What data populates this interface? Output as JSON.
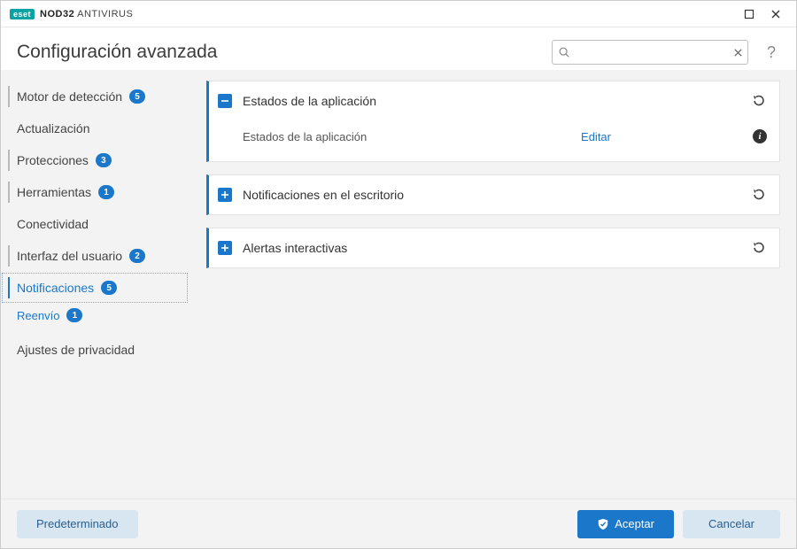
{
  "titlebar": {
    "brand_badge": "eset",
    "brand_bold": "NOD32",
    "brand_rest": "ANTIVIRUS"
  },
  "header": {
    "title": "Configuración avanzada",
    "search_placeholder": ""
  },
  "sidebar": {
    "items": [
      {
        "label": "Motor de detección",
        "badge": "5",
        "accent": true
      },
      {
        "label": "Actualización",
        "badge": null,
        "accent": false
      },
      {
        "label": "Protecciones",
        "badge": "3",
        "accent": true
      },
      {
        "label": "Herramientas",
        "badge": "1",
        "accent": true
      },
      {
        "label": "Conectividad",
        "badge": null,
        "accent": false
      },
      {
        "label": "Interfaz del usuario",
        "badge": "2",
        "accent": true
      },
      {
        "label": "Notificaciones",
        "badge": "5",
        "accent": true,
        "active": true,
        "selected": true,
        "sub": [
          {
            "label": "Reenvío",
            "badge": "1"
          }
        ]
      },
      {
        "label": "Ajustes de privacidad",
        "badge": null,
        "accent": false
      }
    ]
  },
  "main": {
    "panels": [
      {
        "title": "Estados de la aplicación",
        "expanded": true,
        "rows": [
          {
            "label": "Estados de la aplicación",
            "action": "Editar"
          }
        ]
      },
      {
        "title": "Notificaciones en el escritorio",
        "expanded": false
      },
      {
        "title": "Alertas interactivas",
        "expanded": false
      }
    ]
  },
  "footer": {
    "default": "Predeterminado",
    "accept": "Aceptar",
    "cancel": "Cancelar"
  }
}
